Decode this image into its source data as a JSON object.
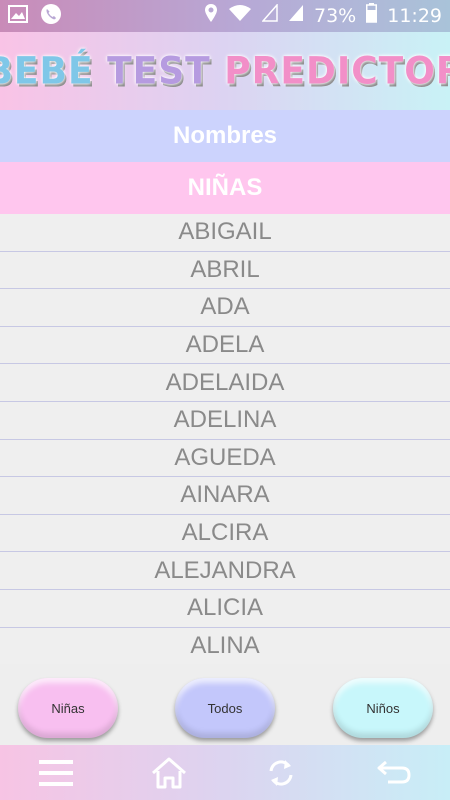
{
  "status_bar": {
    "battery": "73%",
    "time": "11:29",
    "icons": [
      "image-icon",
      "phone-icon",
      "location-icon",
      "wifi-icon",
      "signal-icon",
      "signal-icon",
      "battery-icon"
    ]
  },
  "header": {
    "logo_parts": [
      "BEBÉ",
      "TEST",
      "PREDICTOR"
    ]
  },
  "sections": {
    "title": "Nombres",
    "category": "NIÑAS"
  },
  "names": [
    "ABIGAIL",
    "ABRIL",
    "ADA",
    "ADELA",
    "ADELAIDA",
    "ADELINA",
    "AGUEDA",
    "AINARA",
    "ALCIRA",
    "ALEJANDRA",
    "ALICIA",
    "ALINA"
  ],
  "filters": {
    "girls": "Niñas",
    "all": "Todos",
    "boys": "Niños"
  },
  "nav": {
    "icons": [
      "menu-icon",
      "home-icon",
      "refresh-icon",
      "back-icon"
    ]
  },
  "colors": {
    "names_bar": "#ccd3fd",
    "girls_bar": "#ffc6ee",
    "btn_girls": "#f8bff0",
    "btn_all": "#c3c7fb",
    "btn_boys": "#c8f7fb",
    "name_text": "#8a8a8a"
  }
}
